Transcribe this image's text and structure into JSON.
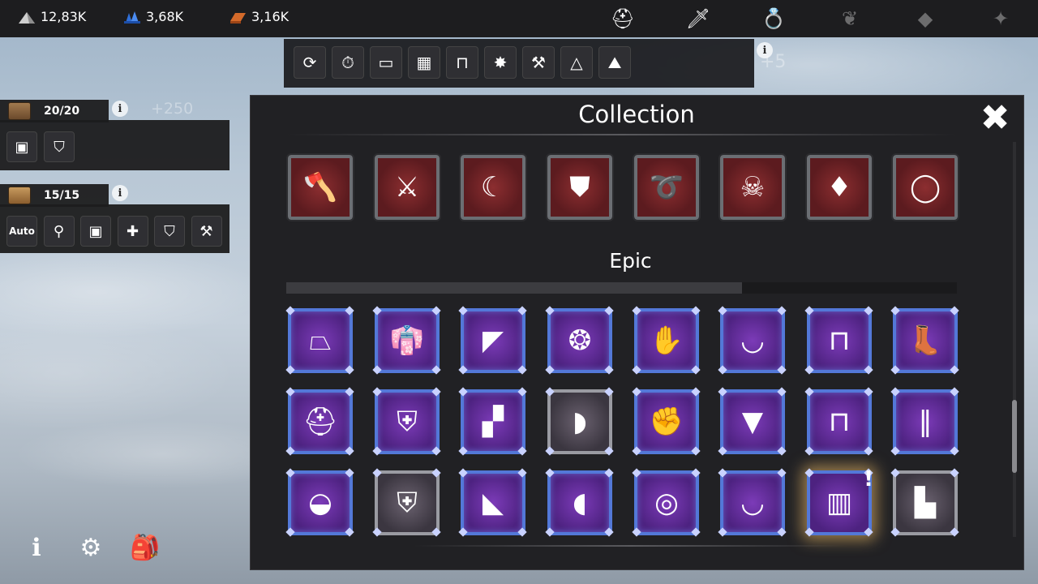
{
  "resources": [
    {
      "icon": "stone-pile-icon",
      "value": "12,83K"
    },
    {
      "icon": "blue-crystal-icon",
      "value": "3,68K"
    },
    {
      "icon": "copper-ingot-icon",
      "value": "3,16K"
    }
  ],
  "top_tabs": [
    {
      "icon": "helmet-tab-icon",
      "glyph": "⛑",
      "dim": false
    },
    {
      "icon": "sword-tab-icon",
      "glyph": "🗡",
      "dim": false
    },
    {
      "icon": "ring-tab-icon",
      "glyph": "💍",
      "dim": false
    },
    {
      "icon": "laurel-tab-icon",
      "glyph": "❦",
      "dim": true
    },
    {
      "icon": "diamond-tab-icon",
      "glyph": "◆",
      "dim": true
    },
    {
      "icon": "wing-tab-icon",
      "glyph": "✦",
      "dim": true
    }
  ],
  "quick_actions": [
    {
      "icon": "refresh-icon",
      "glyph": "⟳"
    },
    {
      "icon": "timer-icon",
      "glyph": "⏱"
    },
    {
      "icon": "bed-icon",
      "glyph": "▭"
    },
    {
      "icon": "crate-icon",
      "glyph": "▦"
    },
    {
      "icon": "open-chest-icon",
      "glyph": "⊓"
    },
    {
      "icon": "star-burst-icon",
      "glyph": "✸"
    },
    {
      "icon": "craft-icon",
      "glyph": "⚒"
    },
    {
      "icon": "tent-icon",
      "glyph": "△"
    },
    {
      "icon": "ore-icon",
      "glyph": "⛰"
    }
  ],
  "quickbar_ghost": "+5",
  "panel1": {
    "counter": "20/20",
    "ghost": "+250",
    "buttons": [
      {
        "icon": "chest-icon",
        "glyph": "▣"
      },
      {
        "icon": "shield-icon",
        "glyph": "⛉"
      }
    ]
  },
  "panel2": {
    "counter": "15/15",
    "buttons": [
      {
        "icon": "auto-icon",
        "glyph": "Auto"
      },
      {
        "icon": "hook-icon",
        "glyph": "⚲"
      },
      {
        "icon": "chest-icon",
        "glyph": "▣"
      },
      {
        "icon": "add-item-icon",
        "glyph": "✚"
      },
      {
        "icon": "shield-icon",
        "glyph": "⛉"
      },
      {
        "icon": "hammer-icon",
        "glyph": "⚒"
      }
    ]
  },
  "collection": {
    "title": "Collection",
    "section": "Epic",
    "section_progress": 0.68,
    "scroll_position": 0.72,
    "rare_row": [
      {
        "icon": "axe-icon",
        "glyph": "🪓"
      },
      {
        "icon": "double-axe-icon",
        "glyph": "⚔"
      },
      {
        "icon": "scythe-blade-icon",
        "glyph": "☾"
      },
      {
        "icon": "dark-shield-icon",
        "glyph": "⛊"
      },
      {
        "icon": "whip-icon",
        "glyph": "➰"
      },
      {
        "icon": "bird-mask-icon",
        "glyph": "☠"
      },
      {
        "icon": "red-crystal-icon",
        "glyph": "♦"
      },
      {
        "icon": "spiked-ring-icon",
        "glyph": "◯"
      }
    ],
    "epic_rows": [
      [
        {
          "icon": "tricorn-hat-icon",
          "glyph": "⏢",
          "frame": "purple"
        },
        {
          "icon": "purple-coat-icon",
          "glyph": "👘",
          "frame": "purple"
        },
        {
          "icon": "purple-cloak-icon",
          "glyph": "◤",
          "frame": "purple"
        },
        {
          "icon": "amulet-icon",
          "glyph": "❂",
          "frame": "purple"
        },
        {
          "icon": "glove-icon",
          "glyph": "✋",
          "frame": "purple"
        },
        {
          "icon": "belt-icon",
          "glyph": "◡",
          "frame": "purple"
        },
        {
          "icon": "pants-icon",
          "glyph": "⊓",
          "frame": "purple"
        },
        {
          "icon": "boots-icon",
          "glyph": "👢",
          "frame": "purple"
        }
      ],
      [
        {
          "icon": "knight-helm-icon",
          "glyph": "⛑",
          "frame": "purple"
        },
        {
          "icon": "chest-armor-icon",
          "glyph": "⛨",
          "frame": "purple"
        },
        {
          "icon": "torn-cape-icon",
          "glyph": "▞",
          "frame": "purple"
        },
        {
          "icon": "pauldron-icon",
          "glyph": "◗",
          "frame": "silver"
        },
        {
          "icon": "gauntlet-icon",
          "glyph": "✊",
          "frame": "purple"
        },
        {
          "icon": "skirt-armor-icon",
          "glyph": "▼",
          "frame": "purple"
        },
        {
          "icon": "red-pants-icon",
          "glyph": "⊓",
          "frame": "purple"
        },
        {
          "icon": "greaves-icon",
          "glyph": "‖",
          "frame": "purple"
        }
      ],
      [
        {
          "icon": "red-hood-icon",
          "glyph": "◒",
          "frame": "purple"
        },
        {
          "icon": "leather-vest-icon",
          "glyph": "⛨",
          "frame": "silver"
        },
        {
          "icon": "orange-cape-icon",
          "glyph": "◣",
          "frame": "purple"
        },
        {
          "icon": "bracer-icon",
          "glyph": "◖",
          "frame": "purple"
        },
        {
          "icon": "bracelet-icon",
          "glyph": "◎",
          "frame": "purple"
        },
        {
          "icon": "waist-wrap-icon",
          "glyph": "◡",
          "frame": "purple"
        },
        {
          "icon": "tabard-icon",
          "glyph": "▥",
          "frame": "purple",
          "highlight": true,
          "badge": "!"
        },
        {
          "icon": "shoes-icon",
          "glyph": "▙",
          "frame": "silver"
        }
      ]
    ]
  },
  "bottom_icons": [
    {
      "icon": "info-icon",
      "glyph": "ℹ"
    },
    {
      "icon": "settings-gear-icon",
      "glyph": "⚙"
    },
    {
      "icon": "backpack-icon",
      "glyph": "🎒"
    }
  ],
  "info_glyph": "i",
  "close_glyph": "✖"
}
